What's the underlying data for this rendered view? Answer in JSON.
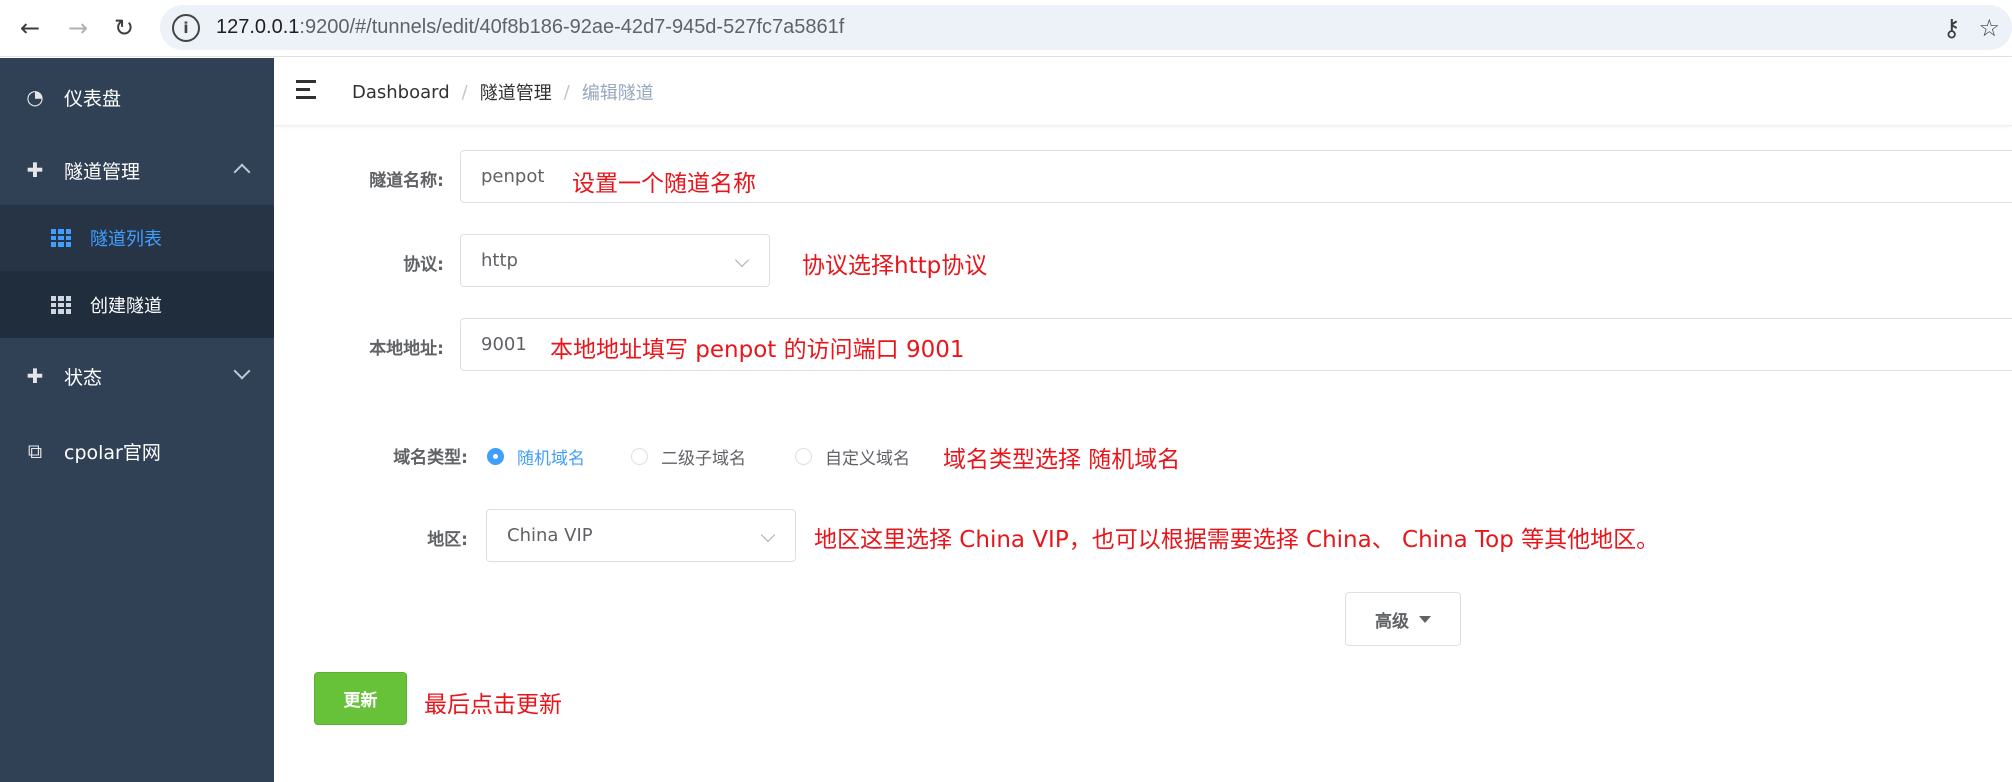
{
  "browser": {
    "url_host": "127.0.0.1",
    "url_rest": ":9200/#/tunnels/edit/40f8b186-92ae-42d7-945d-527fc7a5861f"
  },
  "sidebar": {
    "items": [
      {
        "label": "仪表盘",
        "icon": "dashboard-icon"
      },
      {
        "label": "隧道管理",
        "icon": "tunnel-icon"
      },
      {
        "label": "状态",
        "icon": "status-icon"
      },
      {
        "label": "cpolar官网",
        "icon": "external-link-icon"
      }
    ],
    "submenu": [
      {
        "label": "隧道列表",
        "active": true
      },
      {
        "label": "创建隧道",
        "active": false
      }
    ]
  },
  "breadcrumb": [
    "Dashboard",
    "隧道管理",
    "编辑隧道"
  ],
  "form": {
    "name_label": "隧道名称:",
    "name_value": "penpot",
    "protocol_label": "协议:",
    "protocol_value": "http",
    "local_label": "本地地址:",
    "local_value": "9001",
    "domain_type_label": "域名类型:",
    "domain_options": [
      "随机域名",
      "二级子域名",
      "自定义域名"
    ],
    "region_label": "地区:",
    "region_value": "China VIP",
    "advanced_label": "高级",
    "update_label": "更新"
  },
  "annotations": {
    "name": "设置一个随道名称",
    "protocol": "协议选择http协议",
    "local": "本地地址填写 penpot 的访问端口 9001",
    "domain": "域名类型选择 随机域名",
    "region": "地区这里选择 China VIP，也可以根据需要选择 China、 China Top 等其他地区。",
    "update": "最后点击更新"
  },
  "colors": {
    "sidebar_bg": "#304156",
    "submenu_bg": "#1f2d3d",
    "active": "#409eff",
    "annotation": "#e8161b",
    "update_button": "#67c23a"
  }
}
